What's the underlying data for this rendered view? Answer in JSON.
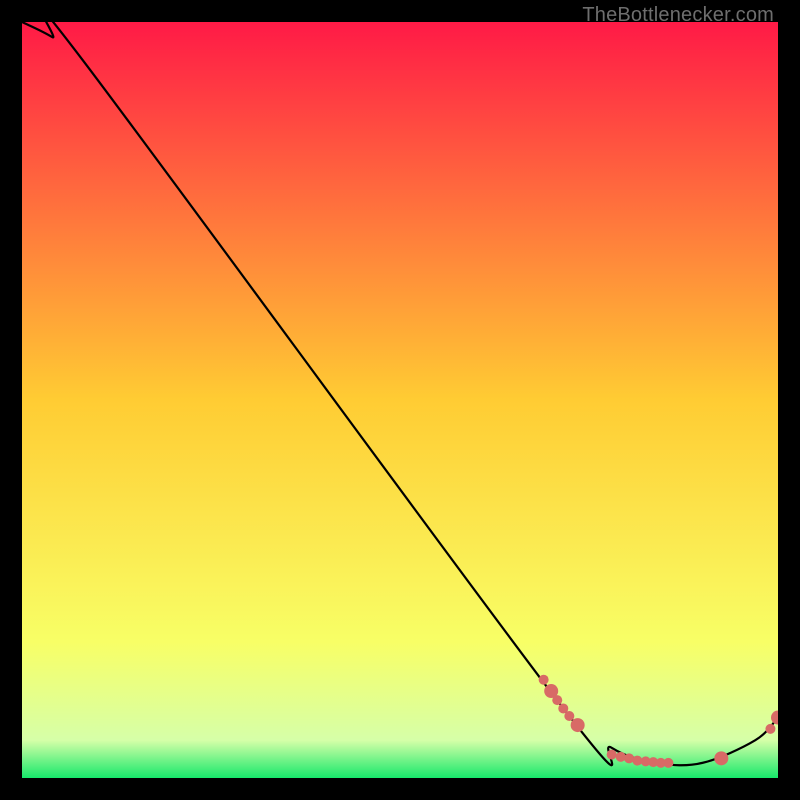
{
  "attribution": "TheBottlenecker.com",
  "chart_data": {
    "type": "line",
    "title": "",
    "xlabel": "",
    "ylabel": "",
    "xlim": [
      0,
      100
    ],
    "ylim": [
      0,
      100
    ],
    "grid": false,
    "legend": false,
    "gradient_stops": [
      {
        "pos": 0.0,
        "color": "#ff1a46"
      },
      {
        "pos": 0.5,
        "color": "#ffcc33"
      },
      {
        "pos": 0.82,
        "color": "#f8ff66"
      },
      {
        "pos": 0.95,
        "color": "#d6ffa8"
      },
      {
        "pos": 1.0,
        "color": "#17e86b"
      }
    ],
    "series": [
      {
        "name": "bottleneck-curve",
        "x": [
          0,
          4,
          8,
          71,
          78,
          84,
          90,
          97,
          100
        ],
        "y": [
          100,
          98,
          95,
          10,
          4,
          2,
          2,
          5,
          8
        ]
      }
    ],
    "markers": {
      "name": "highlight-points",
      "color": "#d86a66",
      "radius_small": 5,
      "radius_large": 7,
      "points": [
        {
          "x": 69.0,
          "y": 13.0,
          "r": "small"
        },
        {
          "x": 70.0,
          "y": 11.5,
          "r": "large"
        },
        {
          "x": 70.8,
          "y": 10.3,
          "r": "small"
        },
        {
          "x": 71.6,
          "y": 9.2,
          "r": "small"
        },
        {
          "x": 72.4,
          "y": 8.2,
          "r": "small"
        },
        {
          "x": 73.5,
          "y": 7.0,
          "r": "large"
        },
        {
          "x": 78.0,
          "y": 3.1,
          "r": "small"
        },
        {
          "x": 79.2,
          "y": 2.8,
          "r": "small"
        },
        {
          "x": 80.3,
          "y": 2.6,
          "r": "small"
        },
        {
          "x": 81.4,
          "y": 2.3,
          "r": "small"
        },
        {
          "x": 82.5,
          "y": 2.2,
          "r": "small"
        },
        {
          "x": 83.5,
          "y": 2.1,
          "r": "small"
        },
        {
          "x": 84.5,
          "y": 2.0,
          "r": "small"
        },
        {
          "x": 85.5,
          "y": 2.0,
          "r": "small"
        },
        {
          "x": 92.5,
          "y": 2.6,
          "r": "large"
        },
        {
          "x": 99.0,
          "y": 6.5,
          "r": "small"
        },
        {
          "x": 100.0,
          "y": 8.0,
          "r": "large"
        }
      ]
    }
  }
}
